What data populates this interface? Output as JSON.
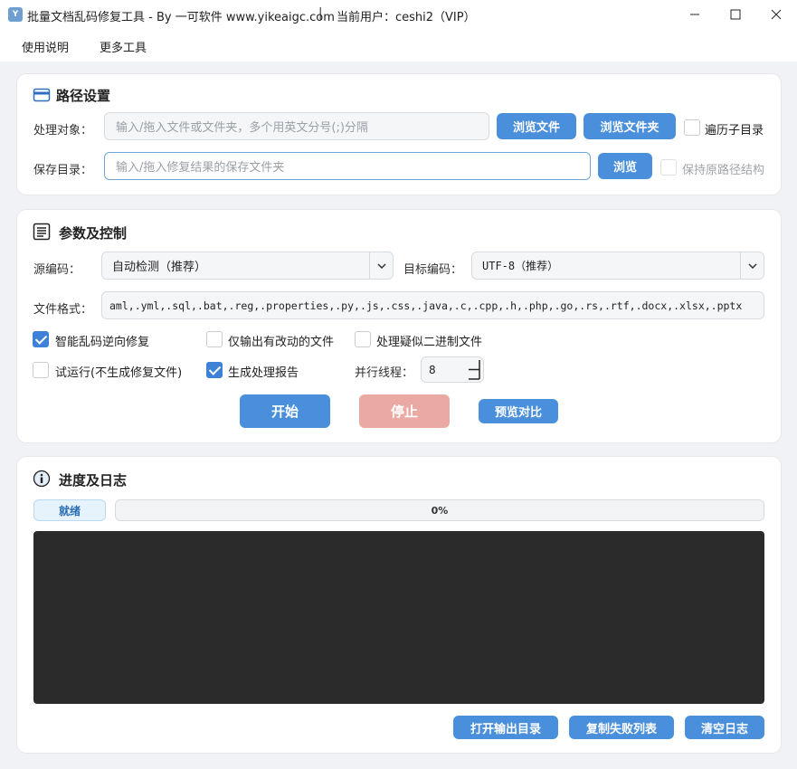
{
  "window": {
    "title": "批量文档乱码修复工具 - By 一可软件 www.yikeaigc.com",
    "separator": "|",
    "user": "当前用户：ceshi2（VIP）",
    "icon_letter": "Y"
  },
  "menu": [
    "使用说明",
    "更多工具"
  ],
  "path_section": {
    "title": "路径设置",
    "target_label": "处理对象：",
    "target_placeholder": "输入/拖入文件或文件夹，多个用英文分号(;)分隔",
    "browse_file": "浏览文件",
    "browse_folder": "浏览文件夹",
    "recursive_label": "遍历子目录",
    "recursive_checked": false,
    "save_label": "保存目录：",
    "save_placeholder": "输入/拖入修复结果的保存文件夹",
    "browse": "浏览",
    "keep_structure_label": "保持原路径结构",
    "keep_structure_checked": false
  },
  "params_section": {
    "title": "参数及控制",
    "source_label": "源编码：",
    "source_value": "自动检测（推荐）",
    "target_label": "目标编码：",
    "target_value": "UTF-8（推荐）",
    "format_label": "文件格式：",
    "format_value": "aml,.yml,.sql,.bat,.reg,.properties,.py,.js,.css,.java,.c,.cpp,.h,.php,.go,.rs,.rtf,.docx,.xlsx,.pptx",
    "options": [
      {
        "label": "智能乱码逆向修复",
        "checked": true
      },
      {
        "label": "仅输出有改动的文件",
        "checked": false
      },
      {
        "label": "处理疑似二进制文件",
        "checked": false
      },
      {
        "label": "试运行(不生成修复文件)",
        "checked": false
      },
      {
        "label": "生成处理报告",
        "checked": true
      }
    ],
    "threads_label": "并行线程：",
    "threads_value": "8",
    "start": "开始",
    "stop": "停止",
    "preview": "预览对比"
  },
  "log_section": {
    "title": "进度及日志",
    "status": "就绪",
    "progress": 0,
    "progress_text": "0%",
    "open_output": "打开输出目录",
    "copy_failed": "复制失败列表",
    "clear_log": "清空日志"
  },
  "colors": {
    "accent": "#4a8fdc",
    "stop_disabled": "#eba9a3",
    "log_bg": "#2b2b2b"
  }
}
